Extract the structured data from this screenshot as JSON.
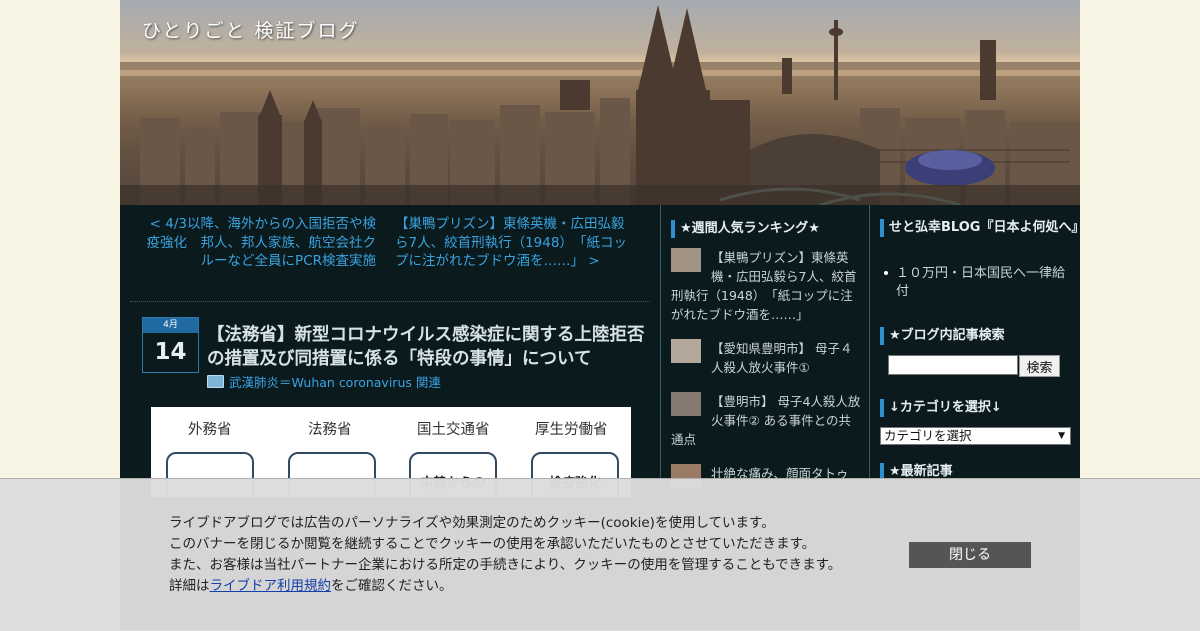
{
  "site": {
    "title": "ひとりごと 検証ブログ"
  },
  "nav": {
    "prev": "< 4/3以降、海外からの入国拒否や検疫強化　邦人、邦人家族、航空会社クルーなど全員にPCR検査実施",
    "next": "【巣鴨プリズン】東條英機・広田弘毅ら7人、絞首刑執行（1948）　「紙コップに注がれたブドウ酒を……」 >"
  },
  "post": {
    "date_month": "4月",
    "date_day": "14",
    "title": "【法務省】新型コロナウイルス感染症に関する上陸拒否の措置及び同措置に係る「特段の事情」について",
    "category": "武漢肺炎＝Wuhan coronavirus 関連",
    "figure": {
      "ministries": [
        "外務省",
        "法務省",
        "国土交通省",
        "厚生労働省"
      ],
      "boxes": [
        "",
        "",
        "中韓からの",
        "検疫強化"
      ]
    }
  },
  "sidebar1": {
    "heading": "★週間人気ランキング★",
    "items": [
      "【巣鴨プリズン】東條英機・広田弘毅ら7人、絞首刑執行（1948）　「紙コップに注がれたブドウ酒を……」",
      "【愛知県豊明市】 母子４人殺人放火事件①",
      "【豊明市】 母子4人殺人放火事件② ある事件との共通点",
      "壮絶な痛み、顔面タトゥ"
    ]
  },
  "sidebar2": {
    "blog_heading": "せと弘幸BLOG『日本よ何処へ』",
    "blog_items": [
      "１０万円・日本国民へ一律給付"
    ],
    "search_heading": "★ブログ内記事検索",
    "search_button": "検索",
    "category_heading": "↓カテゴリを選択↓",
    "category_select": "カテゴリを選択",
    "recent_heading": "★最新記事"
  },
  "cookie": {
    "line1": "ライブドアブログでは広告のパーソナライズや効果測定のためクッキー(cookie)を使用しています。",
    "line2": "このバナーを閉じるか閲覧を継続することでクッキーの使用を承認いただいたものとさせていただきます。",
    "line3": "また、お客様は当社パートナー企業における所定の手続きにより、クッキーの使用を管理することもできます。",
    "line4_prefix": "詳細は",
    "line4_link": "ライブドア利用規約",
    "line4_suffix": "をご確認ください。",
    "close_label": "閉じる"
  }
}
